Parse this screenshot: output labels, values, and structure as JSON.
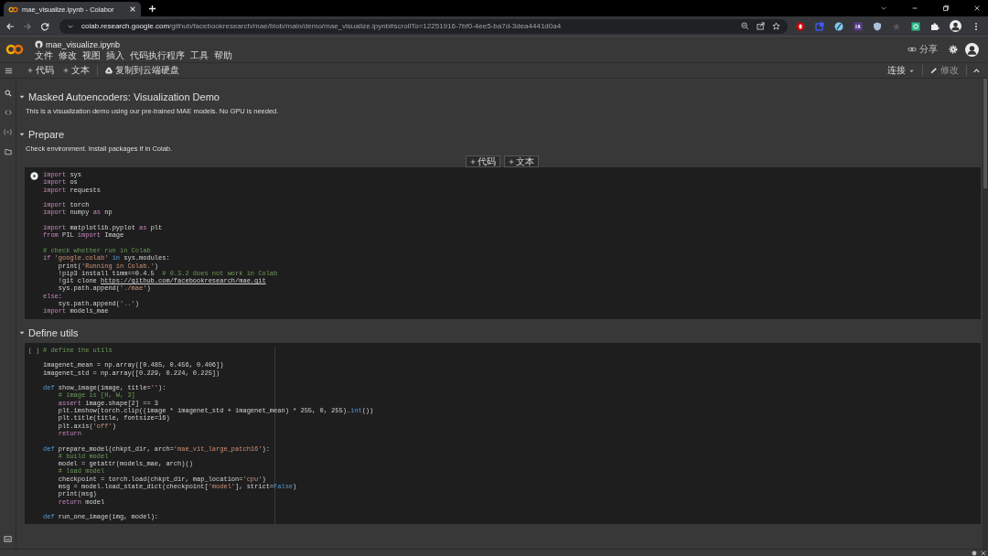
{
  "browser": {
    "tab": {
      "title": "mae_visualize.ipynb - Colabor",
      "selected": true
    },
    "address": {
      "host": "colab.research.google.com",
      "path": "/github/facebookresearch/mae/blob/main/demo/mae_visualize.ipynb#scrollTo=12251916-7bf0-4ee5-ba7d-3dea4441d0a4"
    }
  },
  "notebook": {
    "title": "mae_visualize.ipynb",
    "menu": [
      "文件",
      "修改",
      "视图",
      "插入",
      "代码执行程序",
      "工具",
      "帮助"
    ],
    "share": "分享"
  },
  "toolbar": {
    "left": [
      "代码",
      "文本"
    ],
    "drive": "复制到云端硬盘",
    "connect": "连接",
    "edit": "修改"
  },
  "sections": [
    {
      "title": "Masked Autoencoders: Visualization Demo",
      "expanded": true,
      "text": "This is a visualization demo using our pre-trained MAE models. No GPU is needed."
    },
    {
      "title": "Prepare",
      "expanded": true,
      "text": "Check environment. Install packages if in Colab.",
      "insert": [
        "代码",
        "文本"
      ],
      "cells": [
        {
          "run_button": true,
          "lines": [
            {
              "tokens": [
                {
                  "kind": "kw",
                  "text": "import"
                },
                {
                  "kind": "plain",
                  "text": " sys"
                }
              ]
            },
            {
              "tokens": [
                {
                  "kind": "kw",
                  "text": "import"
                },
                {
                  "kind": "plain",
                  "text": " os"
                }
              ]
            },
            {
              "tokens": [
                {
                  "kind": "kw",
                  "text": "import"
                },
                {
                  "kind": "plain",
                  "text": " requests"
                }
              ]
            },
            {
              "blank_before": true,
              "tokens": [
                {
                  "kind": "kw",
                  "text": "import"
                },
                {
                  "kind": "plain",
                  "text": " torch"
                }
              ]
            },
            {
              "tokens": [
                {
                  "kind": "kw",
                  "text": "import"
                },
                {
                  "kind": "plain",
                  "text": " numpy "
                },
                {
                  "kind": "kw",
                  "text": "as"
                },
                {
                  "kind": "plain",
                  "text": " np"
                }
              ]
            },
            {
              "blank_before": true,
              "tokens": [
                {
                  "kind": "kw",
                  "text": "import"
                },
                {
                  "kind": "plain",
                  "text": " matplotlib.pyplot "
                },
                {
                  "kind": "kw",
                  "text": "as"
                },
                {
                  "kind": "plain",
                  "text": " plt"
                }
              ]
            },
            {
              "tokens": [
                {
                  "kind": "kw",
                  "text": "from"
                },
                {
                  "kind": "plain",
                  "text": " PIL "
                },
                {
                  "kind": "kw",
                  "text": "import"
                },
                {
                  "kind": "plain",
                  "text": " Image"
                }
              ]
            },
            {
              "blank_before": true,
              "tokens": [
                {
                  "kind": "comment",
                  "text": "# check whether run in Colab"
                }
              ]
            },
            {
              "tokens": [
                {
                  "kind": "kw",
                  "text": "if"
                },
                {
                  "kind": "str",
                  "text": " 'google.colab' "
                },
                {
                  "kind": "def",
                  "text": "in"
                },
                {
                  "kind": "plain",
                  "text": " sys.modules:"
                }
              ]
            },
            {
              "tokens": [
                {
                  "kind": "plain",
                  "text": "    print("
                },
                {
                  "kind": "str",
                  "text": "'Running in Colab.'"
                },
                {
                  "kind": "plain",
                  "text": ")"
                }
              ]
            },
            {
              "tokens": [
                {
                  "kind": "plain",
                  "text": "    !pip3 install timm==0.4.5  "
                },
                {
                  "kind": "comment",
                  "text": "# 0.3.2 does not work in Colab"
                }
              ]
            },
            {
              "tokens": [
                {
                  "kind": "plain",
                  "text": "    !git clone "
                },
                {
                  "kind": "link",
                  "text": "https://github.com/facebookresearch/mae.git"
                }
              ]
            },
            {
              "tokens": [
                {
                  "kind": "plain",
                  "text": "    sys.path.append("
                },
                {
                  "kind": "str",
                  "text": "'./mae'"
                },
                {
                  "kind": "plain",
                  "text": ")"
                }
              ]
            },
            {
              "tokens": [
                {
                  "kind": "kw",
                  "text": "else"
                },
                {
                  "kind": "plain",
                  "text": ":"
                }
              ]
            },
            {
              "tokens": [
                {
                  "kind": "plain",
                  "text": "    sys.path.append("
                },
                {
                  "kind": "str",
                  "text": "'..'"
                },
                {
                  "kind": "plain",
                  "text": ")"
                }
              ]
            },
            {
              "tokens": [
                {
                  "kind": "kw",
                  "text": "import"
                },
                {
                  "kind": "plain",
                  "text": " models_mae"
                }
              ]
            }
          ]
        }
      ]
    },
    {
      "title": "Define utils",
      "expanded": true,
      "cells": [
        {
          "marker": "[ ]",
          "lines": [
            {
              "tokens": [
                {
                  "kind": "comment",
                  "text": "# define the utils"
                }
              ]
            },
            {
              "blank_before": true,
              "tokens": [
                {
                  "kind": "plain",
                  "text": "imagenet_mean = np.array([0.485, 0.456, 0.406])"
                }
              ]
            },
            {
              "tokens": [
                {
                  "kind": "plain",
                  "text": "imagenet_std = np.array([0.229, 0.224, 0.225])"
                }
              ]
            },
            {
              "blank_before": true,
              "tokens": [
                {
                  "kind": "def",
                  "text": "def"
                },
                {
                  "kind": "plain",
                  "text": " show_image(image, title="
                },
                {
                  "kind": "str",
                  "text": "''"
                },
                {
                  "kind": "plain",
                  "text": "):"
                }
              ]
            },
            {
              "tokens": [
                {
                  "kind": "comment",
                  "text": "    # image is [H, W, 3]"
                }
              ]
            },
            {
              "tokens": [
                {
                  "kind": "kw",
                  "text": "    assert"
                },
                {
                  "kind": "plain",
                  "text": " image.shape[2] == 3"
                }
              ]
            },
            {
              "tokens": [
                {
                  "kind": "plain",
                  "text": "    plt.imshow(torch.clip((image * imagenet_std + imagenet_mean) * 255, 0, 255)."
                },
                {
                  "kind": "def",
                  "text": "int"
                },
                {
                  "kind": "plain",
                  "text": "())"
                }
              ]
            },
            {
              "tokens": [
                {
                  "kind": "plain",
                  "text": "    plt.title(title, fontsize=16)"
                }
              ]
            },
            {
              "tokens": [
                {
                  "kind": "plain",
                  "text": "    plt.axis("
                },
                {
                  "kind": "str",
                  "text": "'off'"
                },
                {
                  "kind": "plain",
                  "text": ")"
                }
              ]
            },
            {
              "tokens": [
                {
                  "kind": "kw",
                  "text": "    return"
                }
              ]
            },
            {
              "blank_before": true,
              "tokens": [
                {
                  "kind": "def",
                  "text": "def"
                },
                {
                  "kind": "plain",
                  "text": " prepare_model(chkpt_dir, arch="
                },
                {
                  "kind": "str",
                  "text": "'mae_vit_large_patch16'"
                },
                {
                  "kind": "plain",
                  "text": "):"
                }
              ]
            },
            {
              "tokens": [
                {
                  "kind": "comment",
                  "text": "    # build model"
                }
              ]
            },
            {
              "tokens": [
                {
                  "kind": "plain",
                  "text": "    model = getattr(models_mae, arch)()"
                }
              ]
            },
            {
              "tokens": [
                {
                  "kind": "comment",
                  "text": "    # load model"
                }
              ]
            },
            {
              "tokens": [
                {
                  "kind": "plain",
                  "text": "    checkpoint = torch.load(chkpt_dir, map_location="
                },
                {
                  "kind": "str",
                  "text": "'cpu'"
                },
                {
                  "kind": "plain",
                  "text": ")"
                }
              ]
            },
            {
              "tokens": [
                {
                  "kind": "plain",
                  "text": "    msg = model.load_state_dict(checkpoint["
                },
                {
                  "kind": "str",
                  "text": "'model'"
                },
                {
                  "kind": "plain",
                  "text": "], strict="
                },
                {
                  "kind": "def",
                  "text": "False"
                },
                {
                  "kind": "plain",
                  "text": ")"
                }
              ]
            },
            {
              "tokens": [
                {
                  "kind": "plain",
                  "text": "    print(msg)"
                }
              ]
            },
            {
              "tokens": [
                {
                  "kind": "kw",
                  "text": "    return"
                },
                {
                  "kind": "plain",
                  "text": " model"
                }
              ]
            },
            {
              "blank_before": true,
              "tokens": [
                {
                  "kind": "def",
                  "text": "def"
                },
                {
                  "kind": "plain",
                  "text": " run_one_image(img, model):"
                }
              ]
            }
          ]
        }
      ]
    }
  ]
}
